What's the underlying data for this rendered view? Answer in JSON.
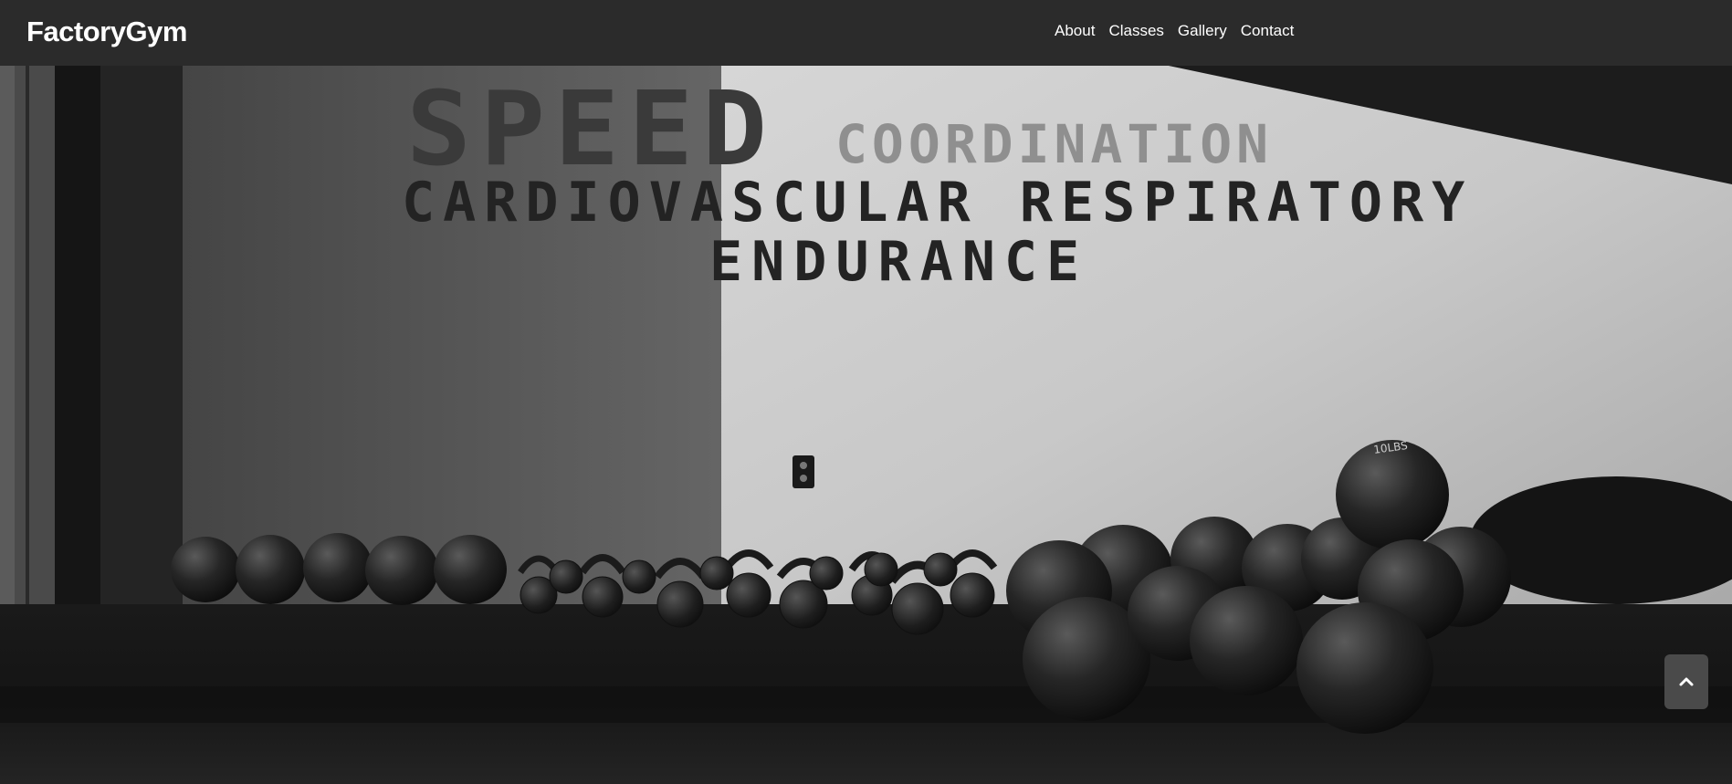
{
  "brand": {
    "name": "FactoryGym"
  },
  "nav": {
    "items": [
      {
        "label": "About"
      },
      {
        "label": "Classes"
      },
      {
        "label": "Gallery"
      },
      {
        "label": "Contact"
      }
    ]
  },
  "hero": {
    "wall_text": {
      "speed": "SPEED",
      "coordination": "COORDINATION",
      "cardio": "CARDIOVASCULAR RESPIRATORY",
      "endurance": "ENDURANCE"
    },
    "ball_label": "10LBS"
  },
  "scroll_top": {
    "icon": "chevron-up-icon"
  },
  "colors": {
    "navbar_bg": "#2b2b2b",
    "text": "#ffffff",
    "scroll_button_bg": "#4a4a4a"
  }
}
